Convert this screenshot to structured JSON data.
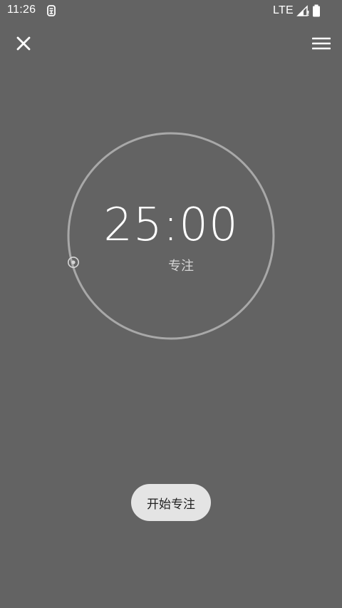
{
  "status_bar": {
    "time": "11:26",
    "network": "LTE",
    "app_icon": "notification-app-icon",
    "signal_icon": "signal-icon",
    "battery_icon": "battery-icon"
  },
  "toolbar": {
    "close_icon": "close-icon",
    "menu_icon": "menu-icon"
  },
  "timer": {
    "time": "25:00",
    "mode_icon": "target-icon",
    "mode_label": "专注"
  },
  "start_button": {
    "label": "开始专注"
  },
  "colors": {
    "background": "#636363",
    "ring": "#a8a8a8",
    "button_bg": "#e4e4e4",
    "button_text": "#222222",
    "text": "#ffffff"
  }
}
